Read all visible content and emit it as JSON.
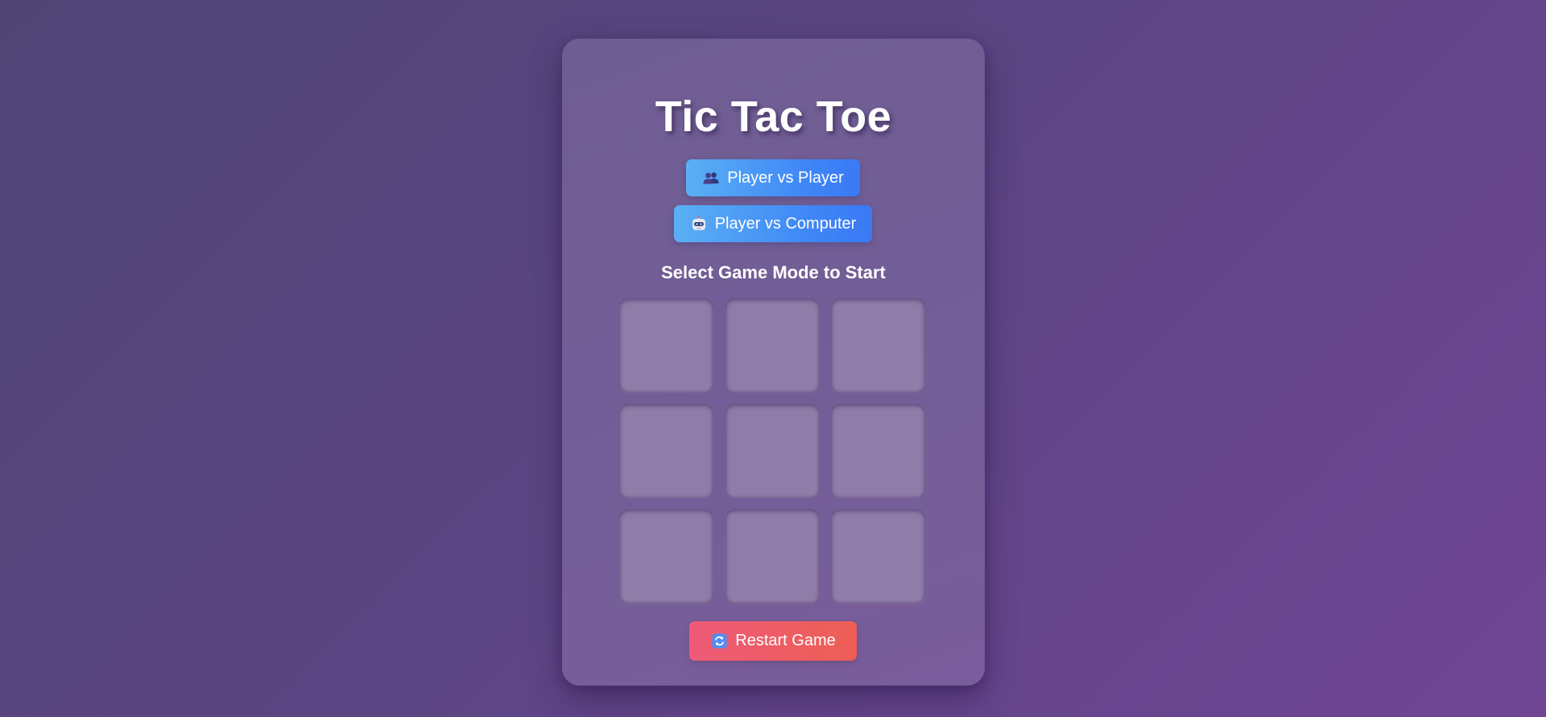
{
  "title": "Tic Tac Toe",
  "modes": {
    "pvp": {
      "label": "Player vs Player",
      "icon": "two-users-icon"
    },
    "pvc": {
      "label": "Player vs Computer",
      "icon": "robot-icon"
    }
  },
  "status": "Select Game Mode to Start",
  "board": {
    "cells": [
      "",
      "",
      "",
      "",
      "",
      "",
      "",
      "",
      ""
    ]
  },
  "restart": {
    "label": "Restart Game",
    "icon": "refresh-icon"
  },
  "colors": {
    "background_start": "#4f4676",
    "background_end": "#6f4594",
    "card": "#735e97",
    "mode_button_start": "#5ab0f4",
    "mode_button_end": "#3a79f5",
    "restart_button_start": "#ee5b78",
    "restart_button_end": "#ee5e55",
    "cell": "#907ca8"
  }
}
